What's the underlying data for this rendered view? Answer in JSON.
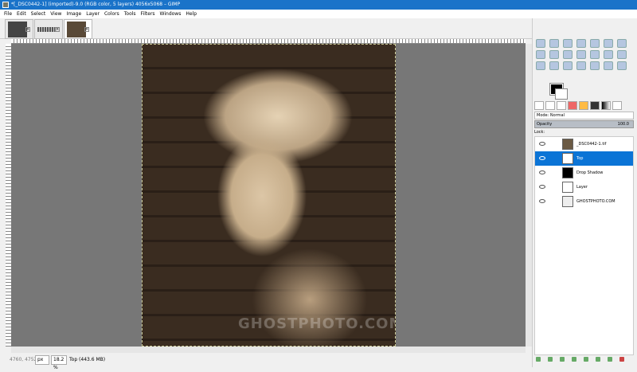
{
  "window": {
    "title": "*[_DSC0442-1] (imported)-9.0 (RGB color, 5 layers) 4056x5068 – GIMP"
  },
  "menu": [
    "File",
    "Edit",
    "Select",
    "View",
    "Image",
    "Layer",
    "Colors",
    "Tools",
    "Filters",
    "Windows",
    "Help"
  ],
  "image": {
    "watermark": "GHOSTPHOTO.COM"
  },
  "status": {
    "coords": "4760, 4752",
    "unit": "px",
    "zoom": "18.2 %",
    "info": "Top (443.6 MB)"
  },
  "layers_panel": {
    "mode": "Mode: Normal",
    "opacity_label": "Opacity",
    "opacity_value": "100.0",
    "lock_label": "Lock:",
    "layers": [
      {
        "name": "_DSC0442-1.tif",
        "selected": false,
        "thumb": "#6b5a44"
      },
      {
        "name": "Top",
        "selected": true,
        "thumb": "#ffffff"
      },
      {
        "name": "Drop Shadow",
        "selected": false,
        "thumb": "#000000"
      },
      {
        "name": "Layer",
        "selected": false,
        "thumb": "#ffffff"
      },
      {
        "name": "GHOSTPHOTO.COM",
        "selected": false,
        "thumb": "#eeeeee"
      }
    ]
  }
}
